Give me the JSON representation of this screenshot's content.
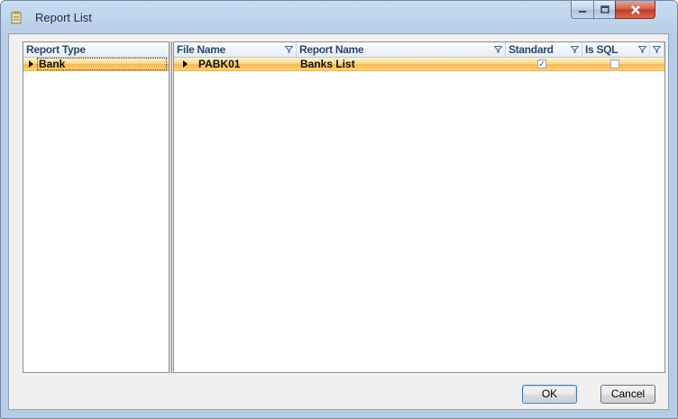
{
  "window": {
    "title": "Report List"
  },
  "left_grid": {
    "column": "Report Type",
    "rows": [
      {
        "label": "Bank",
        "selected": true
      }
    ]
  },
  "right_grid": {
    "columns": [
      "File Name",
      "Report Name",
      "Standard",
      "Is SQL"
    ],
    "rows": [
      {
        "file_name": "PABK01",
        "report_name": "Banks List",
        "standard": true,
        "is_sql": false,
        "selected": true
      }
    ]
  },
  "buttons": {
    "ok": "OK",
    "cancel": "Cancel"
  },
  "icons": {
    "window_icon": "report-icon",
    "filter": "funnel-icon",
    "row_indicator": "triangle-right-icon"
  },
  "colors": {
    "selected_row": "#fcd98c",
    "header_text": "#2d4867",
    "title_bar": "#c9dcf0"
  }
}
